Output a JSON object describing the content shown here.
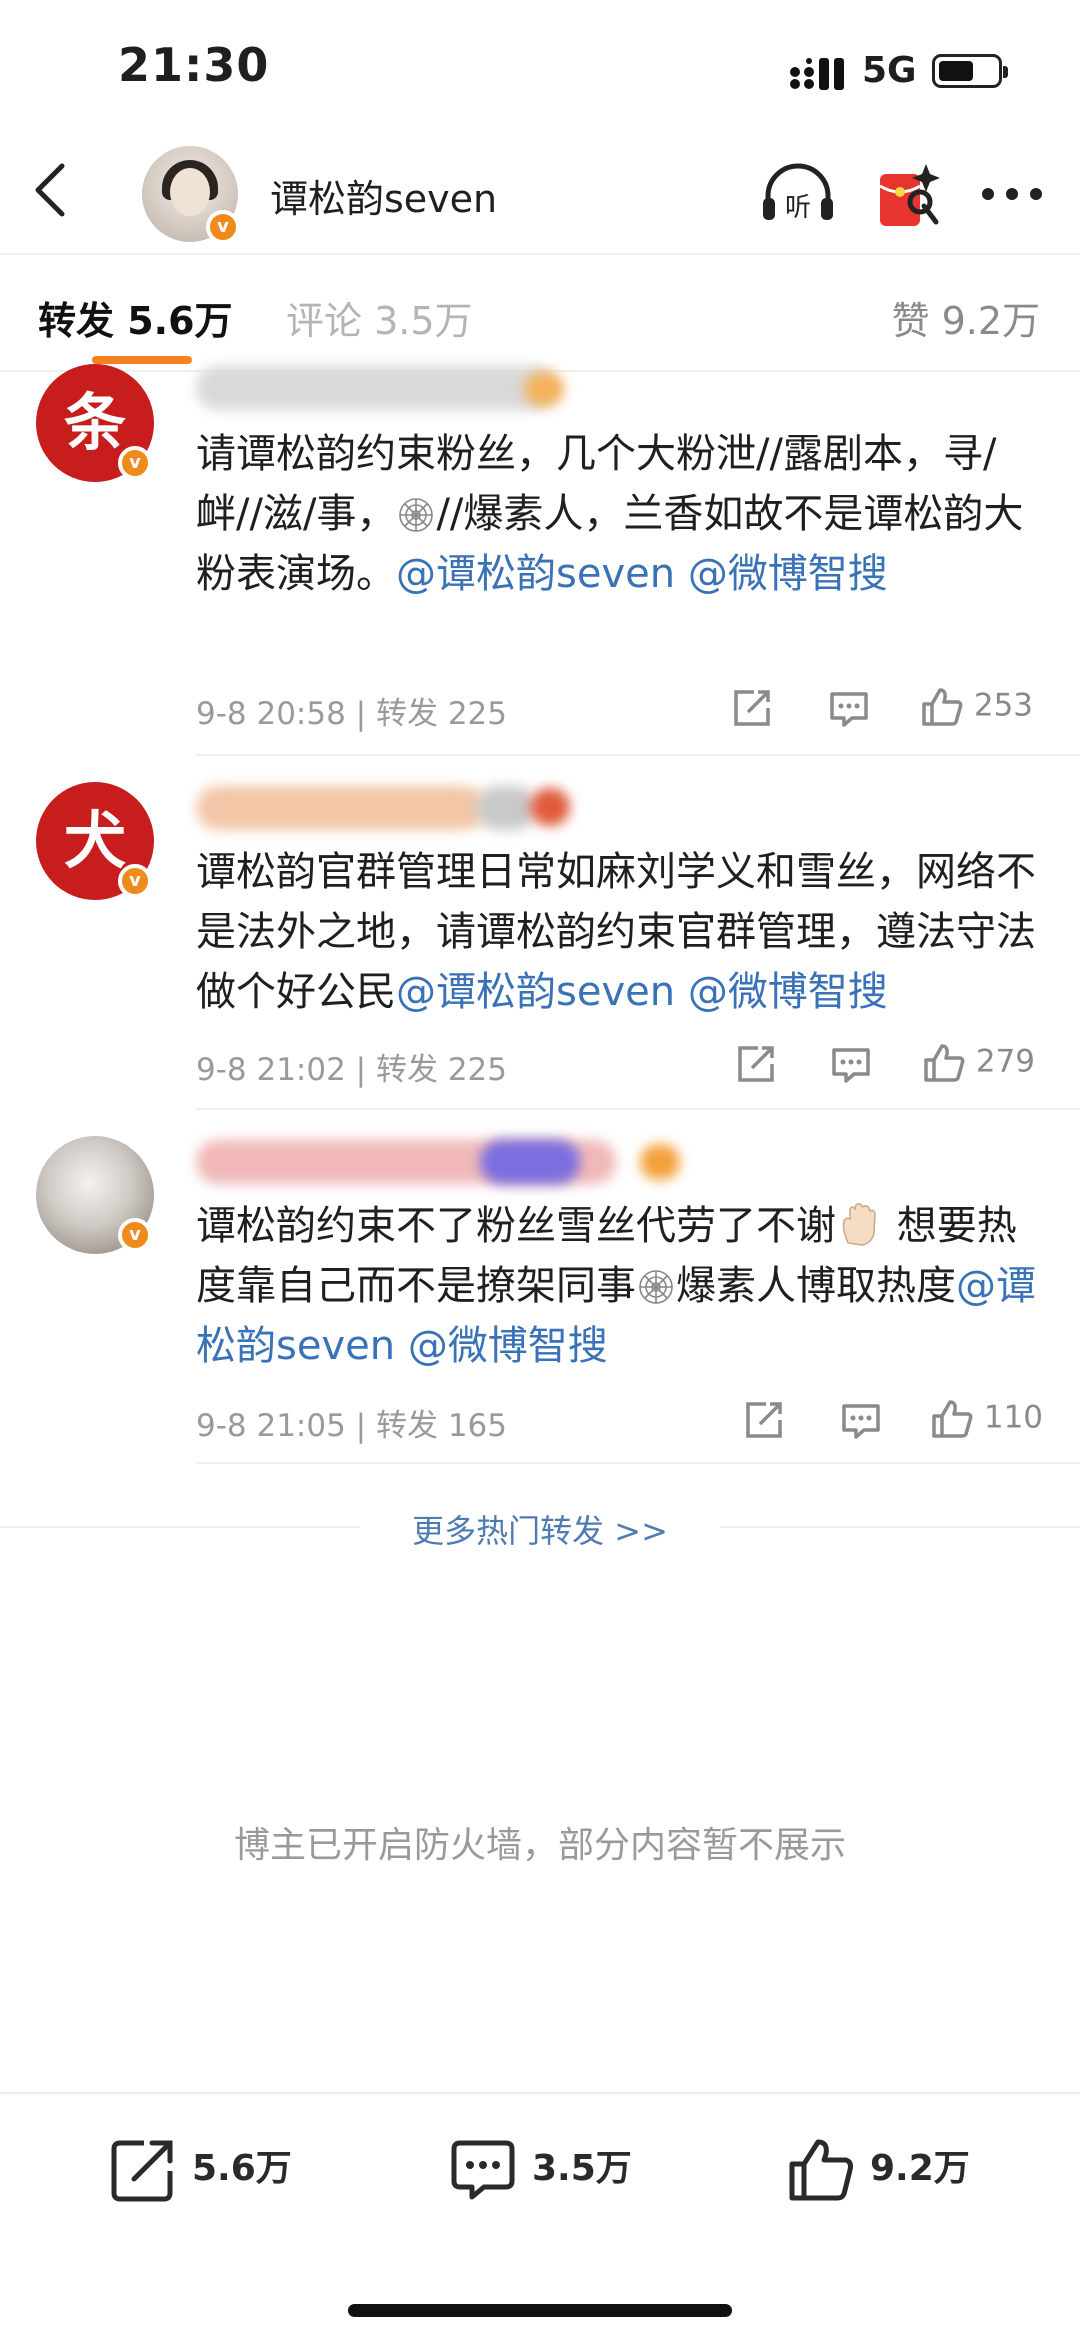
{
  "status_bar": {
    "time": "21:30",
    "network": "5G"
  },
  "header": {
    "title": "谭松韵seven"
  },
  "tabs": {
    "repost": "转发 5.6万",
    "comment": "评论 3.5万",
    "like": "赞 9.2万"
  },
  "posts": [
    {
      "avatar_char": "条",
      "text_prefix": "请谭松韵约束粉丝，几个大粉泄//露剧本，寻/衅//滋/事，",
      "text_middle": "//爆素人，兰香如故不是谭松韵大粉表演场。",
      "mention1": "@谭松韵seven",
      "mention2": "@微博智搜",
      "meta": "9-8 20:58 | 转发 225",
      "likes": "253"
    },
    {
      "avatar_char": "犬",
      "text_prefix": "谭松韵官群管理日常如麻刘学义和雪丝，网络不是法外之地，请谭松韵约束官群管理，遵法守法做个好公民",
      "mention1": "@谭松韵seven",
      "mention2": "@微博智搜",
      "meta": "9-8 21:02 | 转发 225",
      "likes": "279"
    },
    {
      "text_prefix": "谭松韵约束不了粉丝雪丝代劳了不谢",
      "text_middle": "想要热度靠自己而不是撩架同事",
      "text_suffix": "爆素人博取热度",
      "mention1": "@谭松韵seven",
      "mention2": "@微博智搜",
      "meta": "9-8 21:05 | 转发 165",
      "likes": "110"
    }
  ],
  "more_hot": "更多热门转发 >>",
  "firewall_notice": "博主已开启防火墙，部分内容暂不展示",
  "bottom_bar": {
    "repost": "5.6万",
    "comment": "3.5万",
    "like": "9.2万"
  },
  "icons": [
    "back-icon",
    "verified-icon",
    "listen-icon",
    "red-packet-icon",
    "more-icon",
    "share-icon",
    "comment-icon",
    "like-icon",
    "spider-web-emoji",
    "hand-emoji"
  ],
  "colors": {
    "accent": "#f58220",
    "mention": "#3a72b8",
    "avatar_red": "#c81d1d",
    "verified": "#f08a1d"
  }
}
